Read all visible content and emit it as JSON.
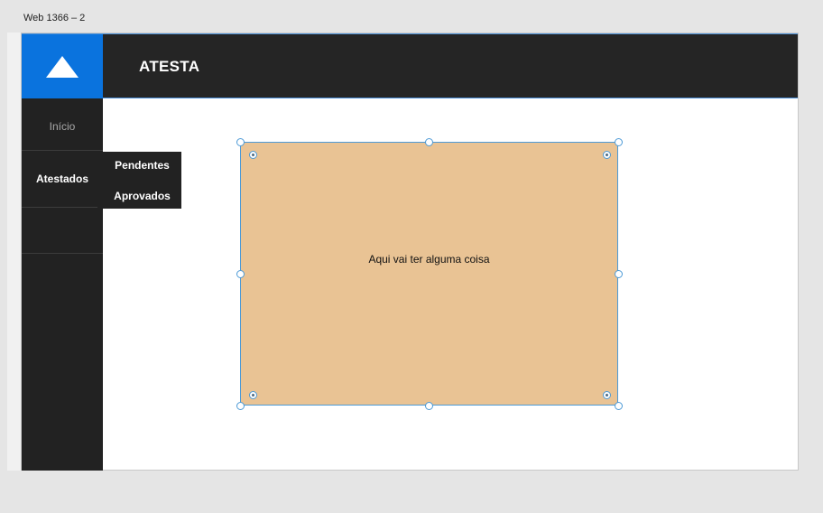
{
  "artboard": {
    "label": "Web 1366 – 2"
  },
  "header": {
    "title": "ATESTA",
    "logo_icon": "triangle-up-icon",
    "accent": "#0a73de"
  },
  "sidebar": {
    "items": [
      {
        "label": "Início"
      },
      {
        "label": "Atestados"
      }
    ]
  },
  "submenu": {
    "items": [
      {
        "label": "Pendentes"
      },
      {
        "label": "Aprovados"
      }
    ]
  },
  "card": {
    "text": "Aqui vai ter alguma coisa",
    "color": "#e9c394"
  }
}
